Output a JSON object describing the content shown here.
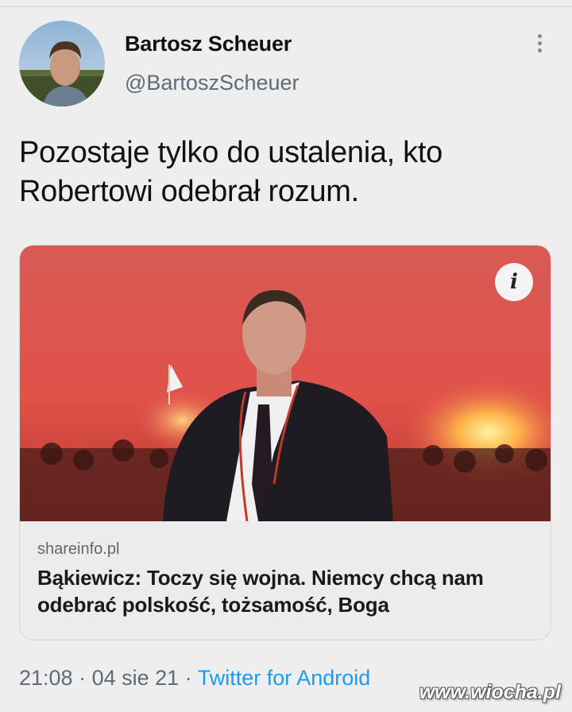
{
  "author": {
    "name": "Bartosz Scheuer",
    "handle": "@BartoszScheuer"
  },
  "tweet": {
    "text": "Pozostaje tylko do ustalenia, kto Robertowi odebrał rozum."
  },
  "card": {
    "domain": "shareinfo.pl",
    "title": "Bąkiewicz: Toczy się wojna. Niemcy chcą nam odebrać polskość, tożsamość, Boga",
    "info_icon": "i"
  },
  "meta": {
    "time": "21:08",
    "date": "04 sie 21",
    "separator": " · ",
    "source": "Twitter for Android"
  },
  "watermark": "www.wiocha.pl",
  "colors": {
    "link": "#1d9bf0",
    "secondary_text": "#5f6b75"
  }
}
